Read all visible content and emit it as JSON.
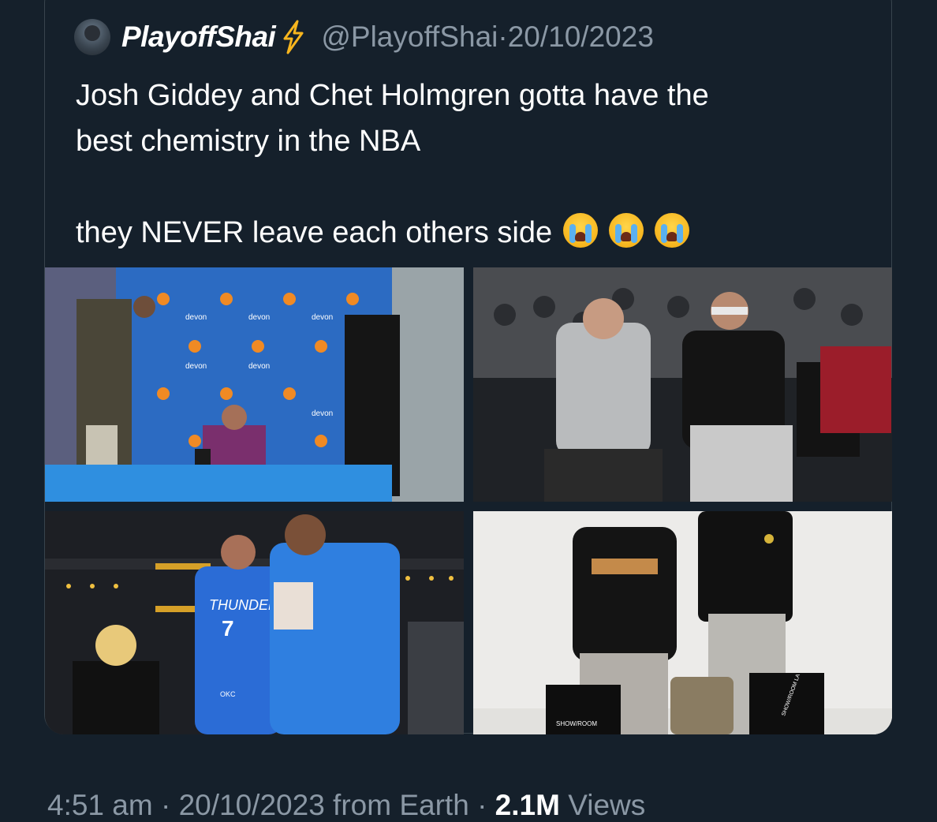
{
  "tweet": {
    "display_name": "PlayoffShai",
    "handle": "@PlayoffShai",
    "separator": "·",
    "date": "20/10/2023",
    "text_line1": "Josh Giddey and Chet Holmgren gotta have the",
    "text_line2": "best chemistry in the NBA",
    "text_line3": "they NEVER leave each others side",
    "emoji_name": "loudly-crying-face-icon",
    "emoji_count": 3,
    "verified_icon": "lightning-bolt-icon",
    "accent_color": "#f7b51e"
  },
  "media": {
    "photo_count": 4,
    "photos": [
      {
        "description_name": "press-conference-photo",
        "texts": [
          "devon",
          "devon",
          "devon",
          "devon",
          "devon",
          "devon"
        ]
      },
      {
        "description_name": "courtside-photo"
      },
      {
        "description_name": "arena-photo",
        "texts": [
          "THUNDER",
          "7",
          "OKC"
        ]
      },
      {
        "description_name": "showroom-photo",
        "texts": [
          "SHOW/ROOM",
          "SHOW/ROOM LA"
        ]
      }
    ]
  },
  "footer": {
    "time": "4:51 am",
    "separator": "·",
    "date": "20/10/2023 from Earth",
    "dot": "·",
    "views_count": "2.1M",
    "views_label": "Views"
  },
  "colors": {
    "background": "#15202b",
    "secondary_text": "#8b98a5",
    "border": "#38444d"
  }
}
